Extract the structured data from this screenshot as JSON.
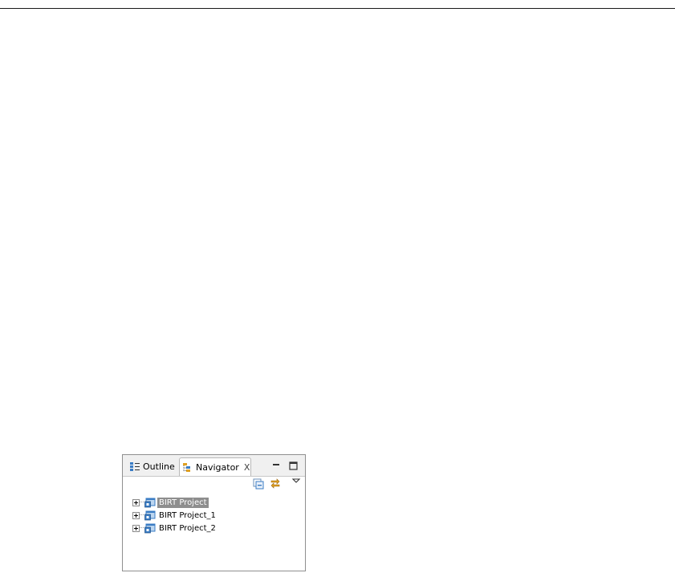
{
  "view": {
    "tabs": [
      {
        "label": "Outline",
        "icon": "outline-icon",
        "active": false
      },
      {
        "label": "Navigator",
        "icon": "navigator-icon",
        "active": true
      }
    ],
    "close_glyph": "X"
  },
  "toolbar": {
    "collapse_all": "collapse-all-icon",
    "link_with_editor": "link-with-editor-icon",
    "view_menu": "view-menu-icon"
  },
  "tree": {
    "items": [
      {
        "label": "BIRT Project",
        "selected": true
      },
      {
        "label": "BIRT Project_1",
        "selected": false
      },
      {
        "label": "BIRT Project_2",
        "selected": false
      }
    ]
  },
  "colors": {
    "selection": "#8e8e8e",
    "tab_bar": "#f0f0f0",
    "link_icon": "#e0a020",
    "project_icon": "#3a7cc4"
  }
}
